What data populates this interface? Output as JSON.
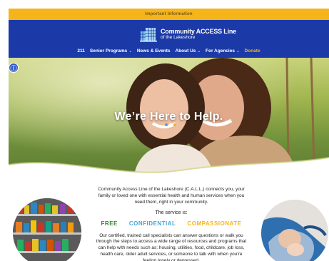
{
  "top_bar": {
    "label": "Important Information"
  },
  "header": {
    "logo": {
      "title": "Community ACCESS Line",
      "subtitle": "of the Lakeshore"
    },
    "nav": [
      {
        "label": "211",
        "has_menu": false
      },
      {
        "label": "Senior Programs",
        "has_menu": true
      },
      {
        "label": "News & Events",
        "has_menu": false
      },
      {
        "label": "About Us",
        "has_menu": true
      },
      {
        "label": "For Agencies",
        "has_menu": true
      },
      {
        "label": "Donate",
        "has_menu": false
      }
    ],
    "colors": {
      "background": "#1b3aa7",
      "accent": "#f5b41a"
    }
  },
  "hero": {
    "headline": "We’re Here to Help.",
    "slider_dot_colors": [
      "#4aa3d8",
      "#ffffff",
      "#f5b41a"
    ]
  },
  "accessibility_button": {
    "icon": "accessibility-icon"
  },
  "main": {
    "intro": "Community Access Line of the Lakeshore (C.A.L.L.) connects you, your family or loved one with essential health and human services when you need them, right in your community.",
    "service_label": "The service is:",
    "pillars": [
      "FREE",
      "CONFIDENTIAL",
      "COMPASSIONATE"
    ],
    "body": "Our certified, trained call specialists can answer questions or walk you through the steps to access a wide range of resources and programs that can help with needs such as: housing, utilities, food, childcare, job loss, health care, older adult services, or someone to talk with when you’re feeling lonely or depressed."
  }
}
